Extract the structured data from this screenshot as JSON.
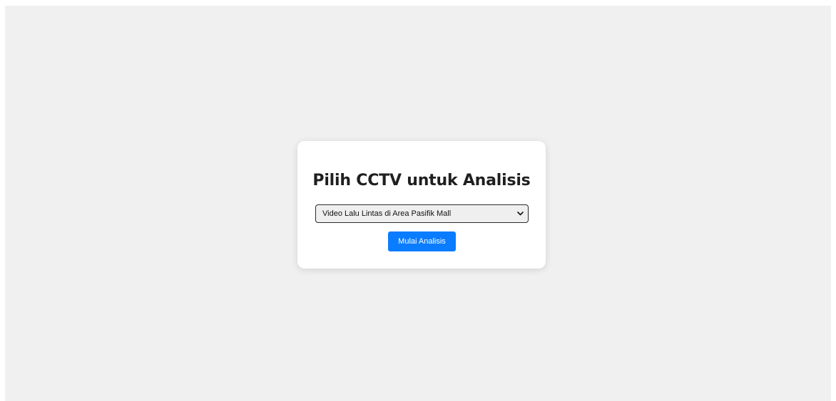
{
  "page": {
    "title": "Pilih CCTV untuk Analisis"
  },
  "form": {
    "cctv_select": {
      "selected": "Video Lalu Lintas di Area Pasifik Mall",
      "icon": "chevron-down-icon"
    },
    "submit_label": "Mulai Analisis"
  },
  "colors": {
    "page_background": "#f0f0f0",
    "card_background": "#ffffff",
    "button_accent": "#0a7cff",
    "title_text": "#1f1f1f"
  }
}
